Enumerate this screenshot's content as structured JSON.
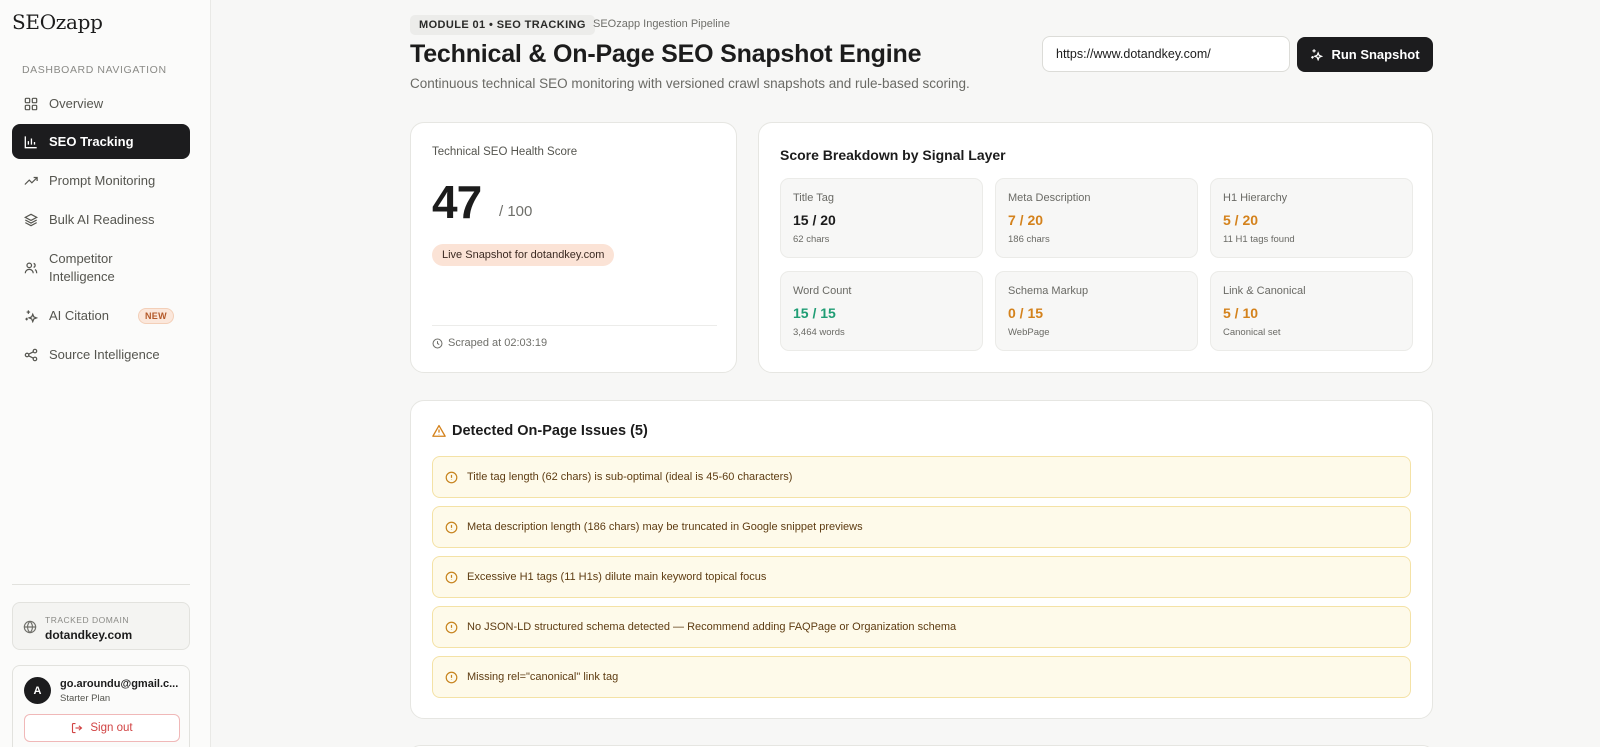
{
  "app": {
    "logo": "SEOzapp"
  },
  "sidebar": {
    "section_label": "DASHBOARD NAVIGATION",
    "items": [
      {
        "label": "Overview",
        "icon": "grid-icon"
      },
      {
        "label": "SEO Tracking",
        "icon": "bar-chart-icon",
        "active": true
      },
      {
        "label": "Prompt Monitoring",
        "icon": "trending-up-icon"
      },
      {
        "label": "Bulk AI Readiness",
        "icon": "layers-icon"
      },
      {
        "label": "Competitor Intelligence",
        "icon": "users-icon"
      },
      {
        "label": "AI Citation",
        "icon": "sparkles-icon",
        "badge": "NEW"
      },
      {
        "label": "Source Intelligence",
        "icon": "share-icon"
      }
    ],
    "tracked_domain": {
      "label": "TRACKED DOMAIN",
      "value": "dotandkey.com"
    },
    "user": {
      "initial": "A",
      "email": "go.aroundu@gmail.c...",
      "plan": "Starter Plan",
      "signout_label": "Sign out"
    }
  },
  "header": {
    "module_badge": "MODULE 01 • SEO TRACKING",
    "pipeline": "SEOzapp Ingestion Pipeline",
    "title": "Technical & On-Page SEO Snapshot Engine",
    "subtitle": "Continuous technical SEO monitoring with versioned crawl snapshots and rule-based scoring.",
    "url_value": "https://www.dotandkey.com/",
    "run_label": "Run Snapshot"
  },
  "health": {
    "label": "Technical SEO Health Score",
    "score": "47",
    "max": "/ 100",
    "live_badge": "Live Snapshot for dotandkey.com",
    "scraped": "Scraped at 02:03:19"
  },
  "breakdown": {
    "title": "Score Breakdown by Signal Layer",
    "metrics": [
      {
        "label": "Title Tag",
        "value": "15 / 20",
        "note": "62 chars",
        "color": "#1c1c1c"
      },
      {
        "label": "Meta Description",
        "value": "7 / 20",
        "note": "186 chars",
        "color": "#d4821c"
      },
      {
        "label": "H1 Hierarchy",
        "value": "5 / 20",
        "note": "11 H1 tags found",
        "color": "#d4821c"
      },
      {
        "label": "Word Count",
        "value": "15 / 15",
        "note": "3,464 words",
        "color": "#1f9d74"
      },
      {
        "label": "Schema Markup",
        "value": "0 / 15",
        "note": "WebPage",
        "color": "#d4821c"
      },
      {
        "label": "Link & Canonical",
        "value": "5 / 10",
        "note": "Canonical set",
        "color": "#d4821c"
      }
    ]
  },
  "issues": {
    "title": "Detected On-Page Issues (5)",
    "items": [
      "Title tag length (62 chars) is sub-optimal (ideal is 45-60 characters)",
      "Meta description length (186 chars) may be truncated in Google snippet previews",
      "Excessive H1 tags (11 H1s) dilute main keyword topical focus",
      "No JSON-LD structured schema detected — Recommend adding FAQPage or Organization schema",
      "Missing rel=\"canonical\" link tag"
    ]
  }
}
